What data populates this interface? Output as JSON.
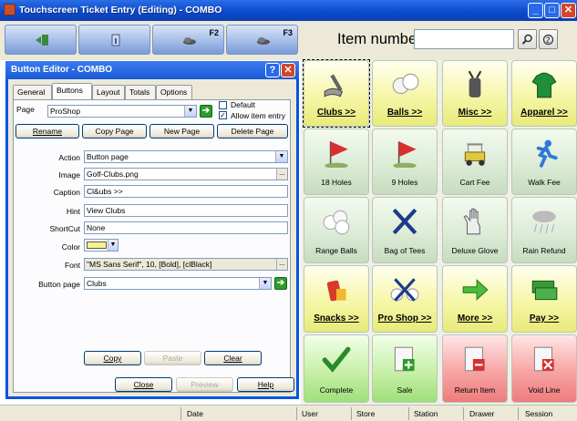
{
  "app": {
    "title": "Touchscreen Ticket Entry (Editing) - COMBO",
    "minimize_icon": "minimize-icon",
    "close_icon": "close-icon"
  },
  "toolbar": {
    "buttons": [
      {
        "icon": "exit-door-icon",
        "key": ""
      },
      {
        "icon": "info-icon",
        "key": ""
      },
      {
        "icon": "shoe-icon",
        "key": "F2"
      },
      {
        "icon": "shoe-icon",
        "key": "F3"
      }
    ],
    "item_number_label": "Item number",
    "item_number_value": "",
    "search_icon": "magnifier-icon",
    "clear_icon": "clear-icon"
  },
  "dialog": {
    "title": "Button Editor - COMBO",
    "help_icon": "?",
    "tabs": [
      "General",
      "Buttons",
      "Layout",
      "Totals",
      "Options"
    ],
    "active_tab": "Buttons",
    "page_label": "Page",
    "page_value": "ProShop",
    "default_label": "Default",
    "allow_item_entry_label": "Allow item entry",
    "default_checked": false,
    "allow_item_entry_checked": true,
    "page_buttons": [
      "Rename",
      "Copy Page",
      "New Page",
      "Delete Page"
    ],
    "fields": {
      "action": {
        "label": "Action",
        "value": "Button page"
      },
      "image": {
        "label": "Image",
        "value": "Golf-Clubs.png"
      },
      "caption": {
        "label": "Caption",
        "value": "Cl&ubs >>"
      },
      "hint": {
        "label": "Hint",
        "value": "View Clubs"
      },
      "shortcut": {
        "label": "ShortCut",
        "value": "None"
      },
      "color": {
        "label": "Color",
        "value": "#f4f48c"
      },
      "font": {
        "label": "Font",
        "value": "\"MS Sans Serif\", 10, [Bold], [clBlack]"
      },
      "button_page": {
        "label": "Button page",
        "value": "Clubs"
      }
    },
    "clipboard_buttons": [
      "Copy",
      "Paste",
      "Clear"
    ],
    "footer_buttons": [
      "Close",
      "Preview",
      "Help"
    ]
  },
  "grid": {
    "tiles": [
      {
        "label": "Clubs >>",
        "icon": "golf-club-icon",
        "style": "y",
        "big": true
      },
      {
        "label": "Balls >>",
        "icon": "golf-balls-icon",
        "style": "y",
        "big": true
      },
      {
        "label": "Misc >>",
        "icon": "golf-bag-icon",
        "style": "y",
        "big": true
      },
      {
        "label": "Apparel >>",
        "icon": "shirt-icon",
        "style": "y",
        "big": true
      },
      {
        "label": "18 Holes",
        "icon": "flag-18-icon",
        "style": "gr",
        "big": false
      },
      {
        "label": "9 Holes",
        "icon": "flag-9-icon",
        "style": "gr",
        "big": false
      },
      {
        "label": "Cart Fee",
        "icon": "golf-cart-icon",
        "style": "gr",
        "big": false
      },
      {
        "label": "Walk Fee",
        "icon": "walking-man-icon",
        "style": "gr",
        "big": false
      },
      {
        "label": "Range Balls",
        "icon": "range-balls-icon",
        "style": "gr",
        "big": false
      },
      {
        "label": "Bag of Tees",
        "icon": "crossed-tees-icon",
        "style": "gr",
        "big": false
      },
      {
        "label": "Deluxe Glove",
        "icon": "glove-icon",
        "style": "gr",
        "big": false
      },
      {
        "label": "Rain Refund",
        "icon": "rain-cloud-icon",
        "style": "gr",
        "big": false
      },
      {
        "label": "Snacks >>",
        "icon": "snacks-icon",
        "style": "y",
        "big": true
      },
      {
        "label": "Pro Shop >>",
        "icon": "pro-shop-icon",
        "style": "y",
        "big": true
      },
      {
        "label": "More >>",
        "icon": "green-arrow-icon",
        "style": "y",
        "big": true
      },
      {
        "label": "Pay >>",
        "icon": "cash-icon",
        "style": "y",
        "big": true
      },
      {
        "label": "Complete",
        "icon": "checkmark-icon",
        "style": "gn",
        "big": false
      },
      {
        "label": "Sale",
        "icon": "receipt-plus-icon",
        "style": "gn",
        "big": false
      },
      {
        "label": "Return Item",
        "icon": "receipt-minus-icon",
        "style": "rd",
        "big": false
      },
      {
        "label": "Void Line",
        "icon": "receipt-void-icon",
        "style": "rd",
        "big": false
      }
    ]
  },
  "status": {
    "fields": [
      "Date",
      "User",
      "Store",
      "Station",
      "Drawer",
      "Session"
    ]
  }
}
